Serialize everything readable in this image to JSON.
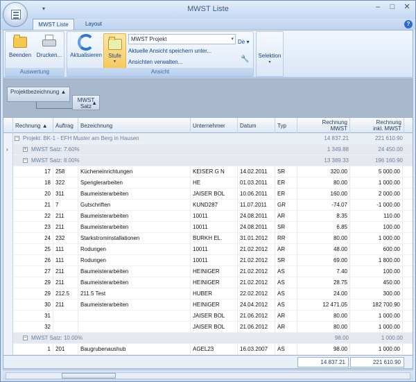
{
  "window": {
    "title": "MWST Liste",
    "qat_label": "▾",
    "minimize": "–",
    "maximize": "□",
    "close": "✕",
    "help": "?"
  },
  "tabs": [
    {
      "label": "MWST Liste",
      "active": true
    },
    {
      "label": "Layout",
      "active": false
    }
  ],
  "ribbon": {
    "auswertung": {
      "label": "Auswertung",
      "beenden": "Beenden",
      "drucken": "Drucken..."
    },
    "ansicht": {
      "label": "Ansicht",
      "aktualisieren": "Aktualisieren",
      "stufe": "Stufe",
      "combo_value": "MWST Projekt",
      "save_view": "Aktuelle Ansicht speichern unter...",
      "manage_views": "Ansichten verwalten...",
      "lang": "De"
    },
    "selektion": {
      "label": "Selektion"
    }
  },
  "grouping": {
    "chip1": "Projektbezeichnung",
    "chip2_line1": "MWST",
    "chip2_line2": "Satz"
  },
  "columns": [
    "Rechnung",
    "Auftrag",
    "Bezeichnung",
    "Unternehmer",
    "Datum",
    "Typ",
    "Rechnung MWST",
    "Rechnung inkl. MWST"
  ],
  "columns_split": {
    "c7a": "Rechnung",
    "c7b": "MWST",
    "c8a": "Rechnung",
    "c8b": "inkl. MWST"
  },
  "groups": {
    "project": {
      "label": "Projekt: BK-1 - EFH Muster    am Berg in Hausen",
      "mwst": "14 837.21",
      "incl": "221 610.90"
    },
    "g760": {
      "label": "MWST Satz: 7.60%",
      "mwst": "1 349.88",
      "incl": "24 450.00"
    },
    "g800": {
      "label": "MWST Satz: 8.00%",
      "mwst": "13 389.33",
      "incl": "196 160.90"
    },
    "g1000": {
      "label": "MWST Satz: 10.00%",
      "mwst": "98.00",
      "incl": "1 000.00"
    }
  },
  "rows": [
    {
      "rechnung": "17",
      "auftrag": "258",
      "bezeichnung": "Kücheneinrichtungen",
      "unternehmer": "KEISER G N",
      "datum": "14.02.2011",
      "typ": "SR",
      "mwst": "320.00",
      "incl": "5 000.00"
    },
    {
      "rechnung": "18",
      "auftrag": "322",
      "bezeichnung": "Spenglerarbeiten",
      "unternehmer": "HE",
      "datum": "01.03.2011",
      "typ": "ER",
      "mwst": "80.00",
      "incl": "1 000.00"
    },
    {
      "rechnung": "20",
      "auftrag": "311",
      "bezeichnung": "Baumeisterarbeiten",
      "unternehmer": "JAISER BOL",
      "datum": "10.06.2011",
      "typ": "ER",
      "mwst": "160.00",
      "incl": "2 000.00"
    },
    {
      "rechnung": "21",
      "auftrag": "7",
      "bezeichnung": "Gutschriften",
      "unternehmer": "KUND287",
      "datum": "11.07.2011",
      "typ": "GR",
      "mwst": "-74.07",
      "incl": "-1 000.00"
    },
    {
      "rechnung": "22",
      "auftrag": "211",
      "bezeichnung": "Baumeisterarbeiten",
      "unternehmer": "10011",
      "datum": "24.08.2011",
      "typ": "AR",
      "mwst": "8.35",
      "incl": "110.00"
    },
    {
      "rechnung": "23",
      "auftrag": "211",
      "bezeichnung": "Baumeisterarbeiten",
      "unternehmer": "10011",
      "datum": "24.08.2011",
      "typ": "SR",
      "mwst": "6.85",
      "incl": "100.00"
    },
    {
      "rechnung": "24",
      "auftrag": "232",
      "bezeichnung": "Starkstrominstallationen",
      "unternehmer": "BURKH EL.",
      "datum": "31.01.2012",
      "typ": "RR",
      "mwst": "80.00",
      "incl": "1 000.00"
    },
    {
      "rechnung": "25",
      "auftrag": "111",
      "bezeichnung": "Rodungen",
      "unternehmer": "10011",
      "datum": "21.02.2012",
      "typ": "AR",
      "mwst": "48.00",
      "incl": "600.00"
    },
    {
      "rechnung": "26",
      "auftrag": "111",
      "bezeichnung": "Rodungen",
      "unternehmer": "10011",
      "datum": "21.02.2012",
      "typ": "SR",
      "mwst": "69.00",
      "incl": "1 800.00"
    },
    {
      "rechnung": "27",
      "auftrag": "211",
      "bezeichnung": "Baumeisterarbeiten",
      "unternehmer": "HEINIGER",
      "datum": "21.02.2012",
      "typ": "AS",
      "mwst": "7.40",
      "incl": "100.00"
    },
    {
      "rechnung": "29",
      "auftrag": "211",
      "bezeichnung": "Baumeisterarbeiten",
      "unternehmer": "HEINIGER",
      "datum": "21.02.2012",
      "typ": "AS",
      "mwst": "28.75",
      "incl": "450.00"
    },
    {
      "rechnung": "29",
      "auftrag": "212.5",
      "bezeichnung": "211.5 Test",
      "unternehmer": "HUBER",
      "datum": "22.02.2012",
      "typ": "AS",
      "mwst": "24.00",
      "incl": "300.00"
    },
    {
      "rechnung": "30",
      "auftrag": "211",
      "bezeichnung": "Baumeisterarbeiten",
      "unternehmer": "HEINIGER",
      "datum": "24.04.2012",
      "typ": "AS",
      "mwst": "12 471.05",
      "incl": "182 700.90"
    },
    {
      "rechnung": "31",
      "auftrag": "",
      "bezeichnung": "",
      "unternehmer": "JAISER BOL",
      "datum": "21.06.2012",
      "typ": "AR",
      "mwst": "80.00",
      "incl": "1 000.00"
    },
    {
      "rechnung": "32",
      "auftrag": "",
      "bezeichnung": "",
      "unternehmer": "JAISER BOL",
      "datum": "21.06.2012",
      "typ": "AR",
      "mwst": "80.00",
      "incl": "1 000.00"
    }
  ],
  "rows_10": [
    {
      "rechnung": "1",
      "auftrag": "201",
      "bezeichnung": "Baugrubenaushub",
      "unternehmer": "AGEL23",
      "datum": "16.03.2007",
      "typ": "AS",
      "mwst": "98.00",
      "incl": "1 000.00"
    }
  ],
  "footer": {
    "mwst": "14 837.21",
    "incl": "221 610.90"
  }
}
